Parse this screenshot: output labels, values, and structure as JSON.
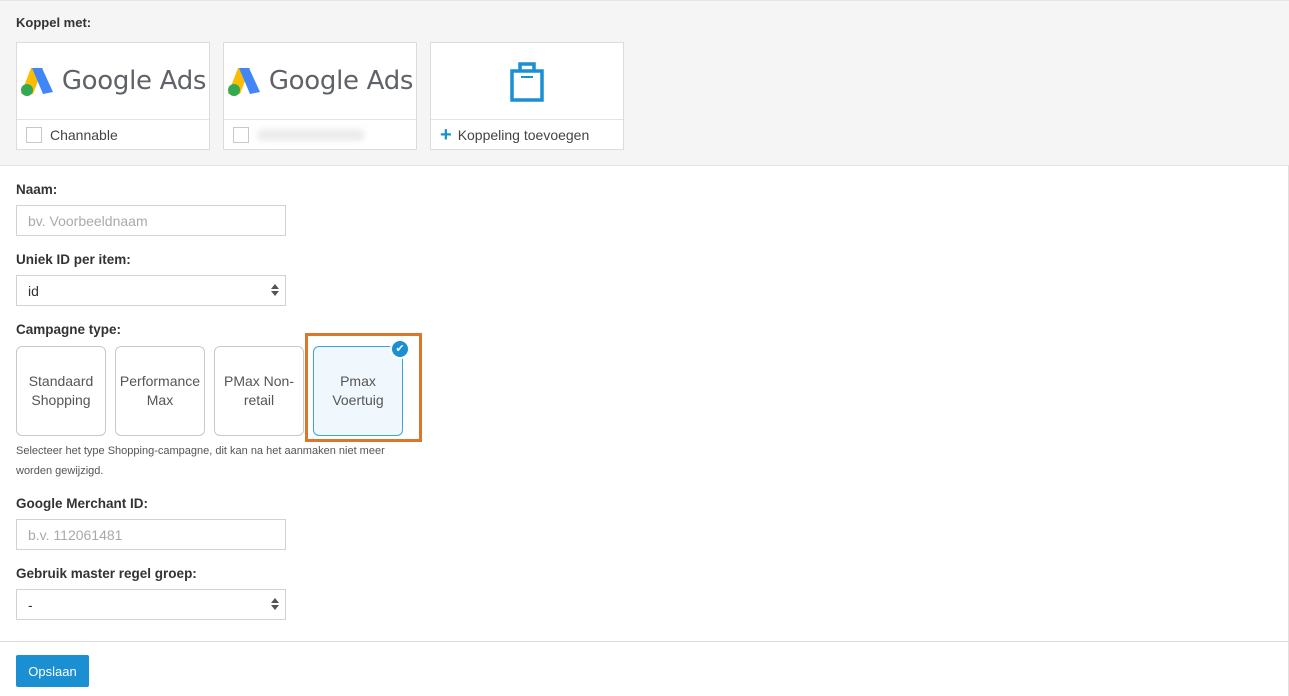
{
  "connect": {
    "label": "Koppel met:",
    "cards": [
      {
        "logo_text": "Google Ads",
        "foot_text": "Channable",
        "icon": "google-ads-logo"
      },
      {
        "logo_text": "Google Ads",
        "foot_text": "",
        "icon": "google-ads-logo"
      },
      {
        "logo_text": "",
        "foot_text": "Koppeling toevoegen",
        "icon": "shopping-bag-icon"
      }
    ]
  },
  "form": {
    "name_label": "Naam:",
    "name_placeholder": "bv. Voorbeeldnaam",
    "unique_id_label": "Uniek ID per item:",
    "unique_id_value": "id",
    "campaign_type_label": "Campagne type:",
    "campaign_types": [
      "Standaard Shopping",
      "Performance Max",
      "PMax Non-retail",
      "Pmax Voertuig"
    ],
    "campaign_type_selected": "Pmax Voertuig",
    "campaign_help": "Selecteer het type Shopping-campagne, dit kan na het aanmaken niet meer worden gewijzigd.",
    "merchant_label": "Google Merchant ID:",
    "merchant_placeholder": "b.v. 112061481",
    "master_group_label": "Gebruik master regel groep:",
    "master_group_value": "-"
  },
  "actions": {
    "save_label": "Opslaan"
  },
  "colors": {
    "accent": "#1a8fd1",
    "highlight": "#d9772c"
  }
}
